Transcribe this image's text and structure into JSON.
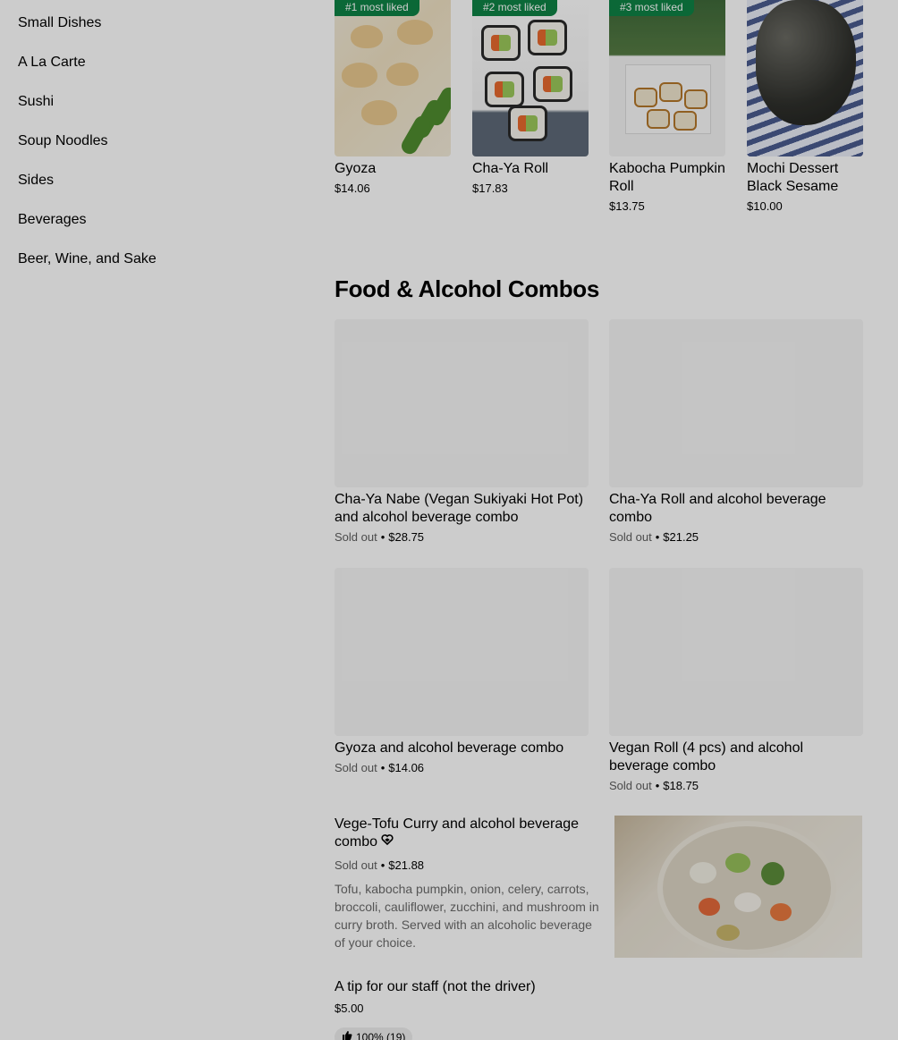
{
  "sidebar": {
    "items": [
      {
        "label": "Small Dishes"
      },
      {
        "label": "A La Carte"
      },
      {
        "label": "Sushi"
      },
      {
        "label": "Soup Noodles"
      },
      {
        "label": "Sides"
      },
      {
        "label": "Beverages"
      },
      {
        "label": "Beer, Wine, and Sake"
      }
    ]
  },
  "liked": [
    {
      "badge": "#1 most liked",
      "name": "Gyoza",
      "price": "$14.06"
    },
    {
      "badge": "#2 most liked",
      "name": "Cha-Ya Roll",
      "price": "$17.83"
    },
    {
      "badge": "#3 most liked",
      "name": "Kabocha Pumpkin Roll",
      "price": "$13.75"
    },
    {
      "badge": "",
      "name": "Mochi Dessert Black Sesame",
      "price": "$10.00"
    }
  ],
  "combos": {
    "title": "Food & Alcohol Combos",
    "items": [
      {
        "name": "Cha-Ya Nabe (Vegan Sukiyaki Hot Pot) and alcohol beverage combo",
        "status": "Sold out",
        "sep": "•",
        "price": "$28.75"
      },
      {
        "name": "Cha-Ya Roll and alcohol beverage combo",
        "status": "Sold out",
        "sep": "•",
        "price": "$21.25"
      },
      {
        "name": "Gyoza and alcohol beverage combo",
        "status": "Sold out",
        "sep": "•",
        "price": "$14.06"
      },
      {
        "name": "Vegan Roll (4 pcs) and alcohol beverage combo",
        "status": "Sold out",
        "sep": "•",
        "price": "$18.75"
      }
    ],
    "featured": {
      "name": "Vege-Tofu Curry and alcohol beverage combo",
      "status": "Sold out",
      "sep": "•",
      "price": "$21.88",
      "description": "Tofu, kabocha pumpkin, onion, celery, carrots, broccoli, cauliflower, zucchini, and mushroom in curry broth. Served with an alcoholic beverage of your choice.",
      "icon": "vegan-heart-icon"
    }
  },
  "tip": {
    "name": "A tip for our staff (not the driver)",
    "price": "$5.00",
    "rating": "100% (19)",
    "icon": "thumbs-up-icon"
  },
  "colors": {
    "badge": "#0e8345",
    "overlay": "rgba(0,0,0,0.2)"
  }
}
